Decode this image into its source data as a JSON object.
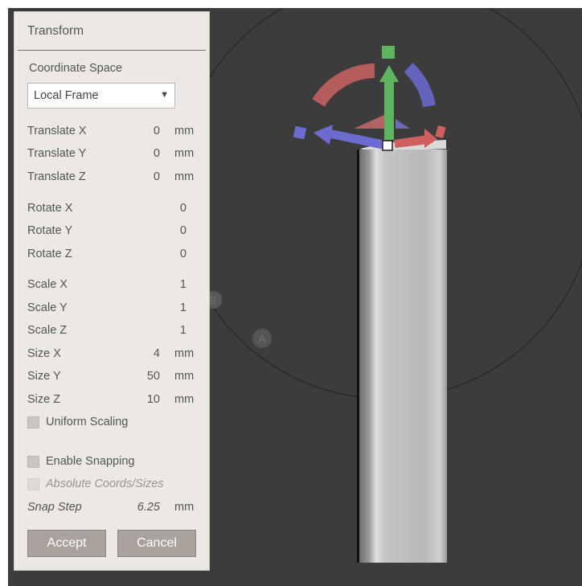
{
  "panel": {
    "title": "Transform",
    "coordinate_space": {
      "label": "Coordinate Space",
      "selected": "Local Frame",
      "caret": "▼"
    },
    "translate": [
      {
        "label": "Translate X",
        "value": "0",
        "unit": "mm"
      },
      {
        "label": "Translate Y",
        "value": "0",
        "unit": "mm"
      },
      {
        "label": "Translate Z",
        "value": "0",
        "unit": "mm"
      }
    ],
    "rotate": [
      {
        "label": "Rotate X",
        "value": "0"
      },
      {
        "label": "Rotate Y",
        "value": "0"
      },
      {
        "label": "Rotate Z",
        "value": "0"
      }
    ],
    "scale": [
      {
        "label": "Scale X",
        "value": "1"
      },
      {
        "label": "Scale Y",
        "value": "1"
      },
      {
        "label": "Scale Z",
        "value": "1"
      }
    ],
    "size": [
      {
        "label": "Size X",
        "value": "4",
        "unit": "mm"
      },
      {
        "label": "Size Y",
        "value": "50",
        "unit": "mm"
      },
      {
        "label": "Size Z",
        "value": "10",
        "unit": "mm"
      }
    ],
    "uniform_scaling": {
      "label": "Uniform Scaling",
      "checked": false
    },
    "enable_snapping": {
      "label": "Enable Snapping",
      "checked": false
    },
    "absolute_coords": {
      "label": "Absolute Coords/Sizes",
      "checked": false,
      "enabled": false
    },
    "snap_step": {
      "label": "Snap Step",
      "value": "6.25",
      "unit": "mm"
    },
    "accept_label": "Accept",
    "cancel_label": "Cancel"
  },
  "viewport": {
    "background": "#3c3c3c",
    "markers": [
      "B",
      "A"
    ],
    "gizmo_colors": {
      "x_axis": "#6b6bd0",
      "y_axis": "#5fb55f",
      "z_axis": "#d06060"
    }
  }
}
